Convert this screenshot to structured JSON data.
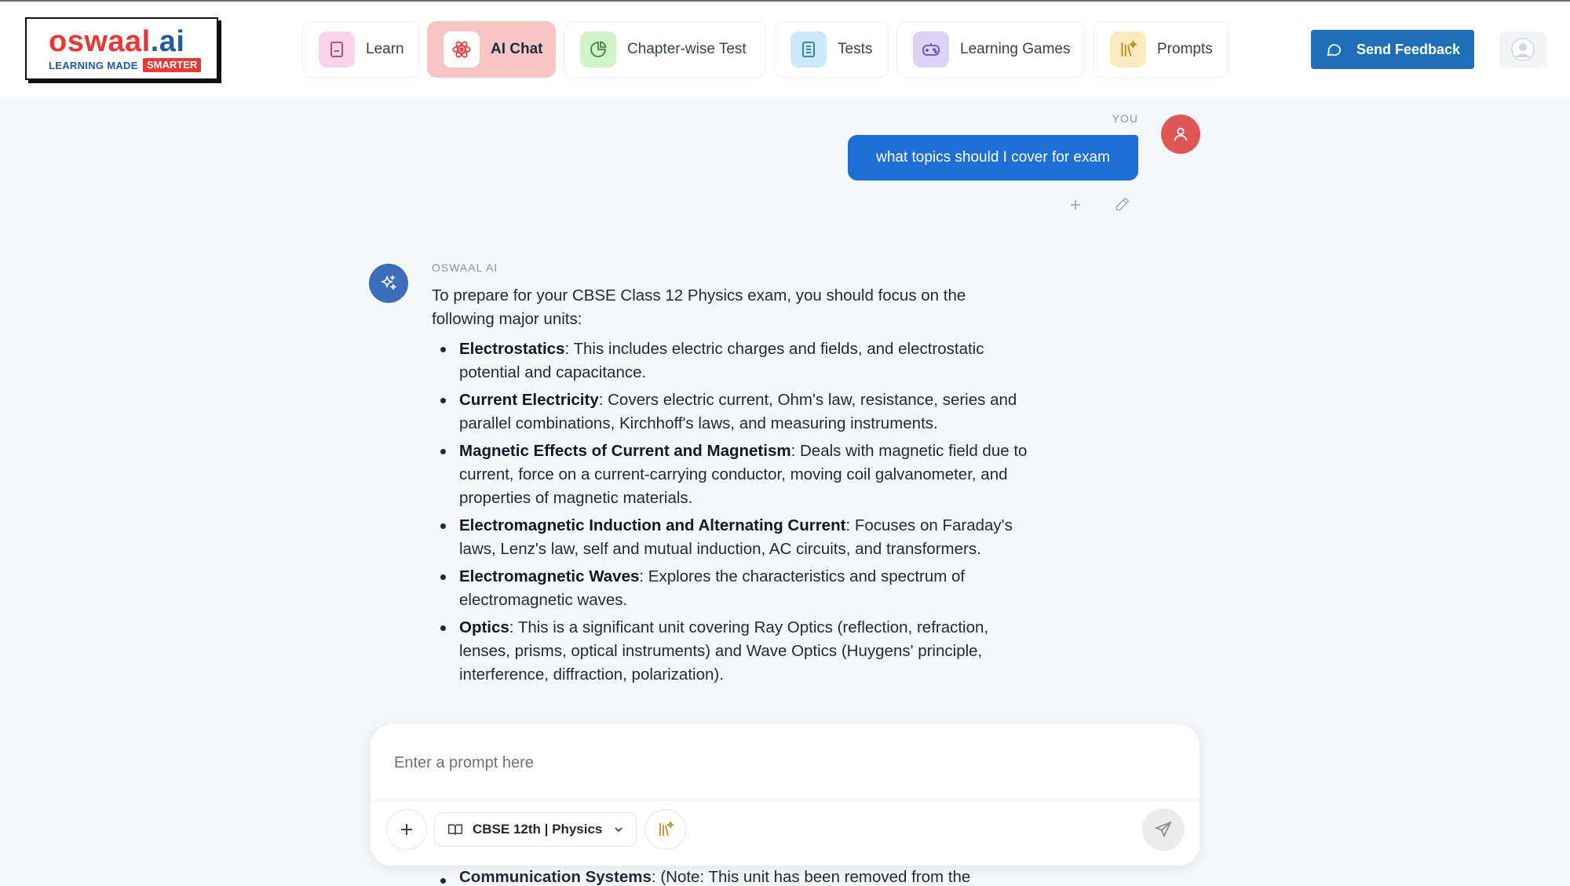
{
  "header": {
    "logo": {
      "brand": "oswaal",
      "brand_suffix": ".ai",
      "tagline": "LEARNING MADE",
      "tagline_highlight": "SMARTER"
    },
    "nav": [
      {
        "label": "Learn",
        "icon": "book-icon",
        "active": false
      },
      {
        "label": "AI Chat",
        "icon": "atom-icon",
        "active": true
      },
      {
        "label": "Chapter-wise Test",
        "icon": "chart-pie-icon",
        "active": false
      },
      {
        "label": "Tests",
        "icon": "document-icon",
        "active": false
      },
      {
        "label": "Learning Games",
        "icon": "gamepad-icon",
        "active": false
      },
      {
        "label": "Prompts",
        "icon": "library-icon",
        "active": false
      }
    ],
    "feedback_label": "Send Feedback"
  },
  "chat": {
    "user": {
      "label": "YOU",
      "message": "what topics should I cover for exam"
    },
    "ai": {
      "label": "OSWAAL AI",
      "intro": "To prepare for your CBSE Class 12 Physics exam, you should focus on the following major units:",
      "items": [
        {
          "title": "Electrostatics",
          "text": ": This includes electric charges and fields, and electrostatic potential and capacitance."
        },
        {
          "title": "Current Electricity",
          "text": ": Covers electric current, Ohm's law, resistance, series and parallel combinations, Kirchhoff's laws, and measuring instruments."
        },
        {
          "title": "Magnetic Effects of Current and Magnetism",
          "text": ": Deals with magnetic field due to current, force on a current-carrying conductor, moving coil galvanometer, and properties of magnetic materials."
        },
        {
          "title": "Electromagnetic Induction and Alternating Current",
          "text": ": Focuses on Faraday's laws, Lenz's law, self and mutual induction, AC circuits, and transformers."
        },
        {
          "title": "Electromagnetic Waves",
          "text": ": Explores the characteristics and spectrum of electromagnetic waves."
        },
        {
          "title": "Optics",
          "text": ": This is a significant unit covering Ray Optics (reflection, refraction, lenses, prisms, optical instruments) and Wave Optics (Huygens' principle, interference, diffraction, polarization)."
        }
      ],
      "peek_title": "Communication Systems",
      "peek_text": ": (Note: This unit has been removed from the"
    }
  },
  "prompt": {
    "placeholder": "Enter a prompt here",
    "subject": "CBSE 12th | Physics"
  },
  "colors": {
    "brand_red": "#e53935",
    "brand_blue": "#1e5aa8",
    "active_tab": "#f7c6c4",
    "feedback_button": "#1e6fb5",
    "user_bubble": "#1d6fd6",
    "ai_avatar": "#3b6dbb",
    "user_avatar": "#e05555"
  }
}
